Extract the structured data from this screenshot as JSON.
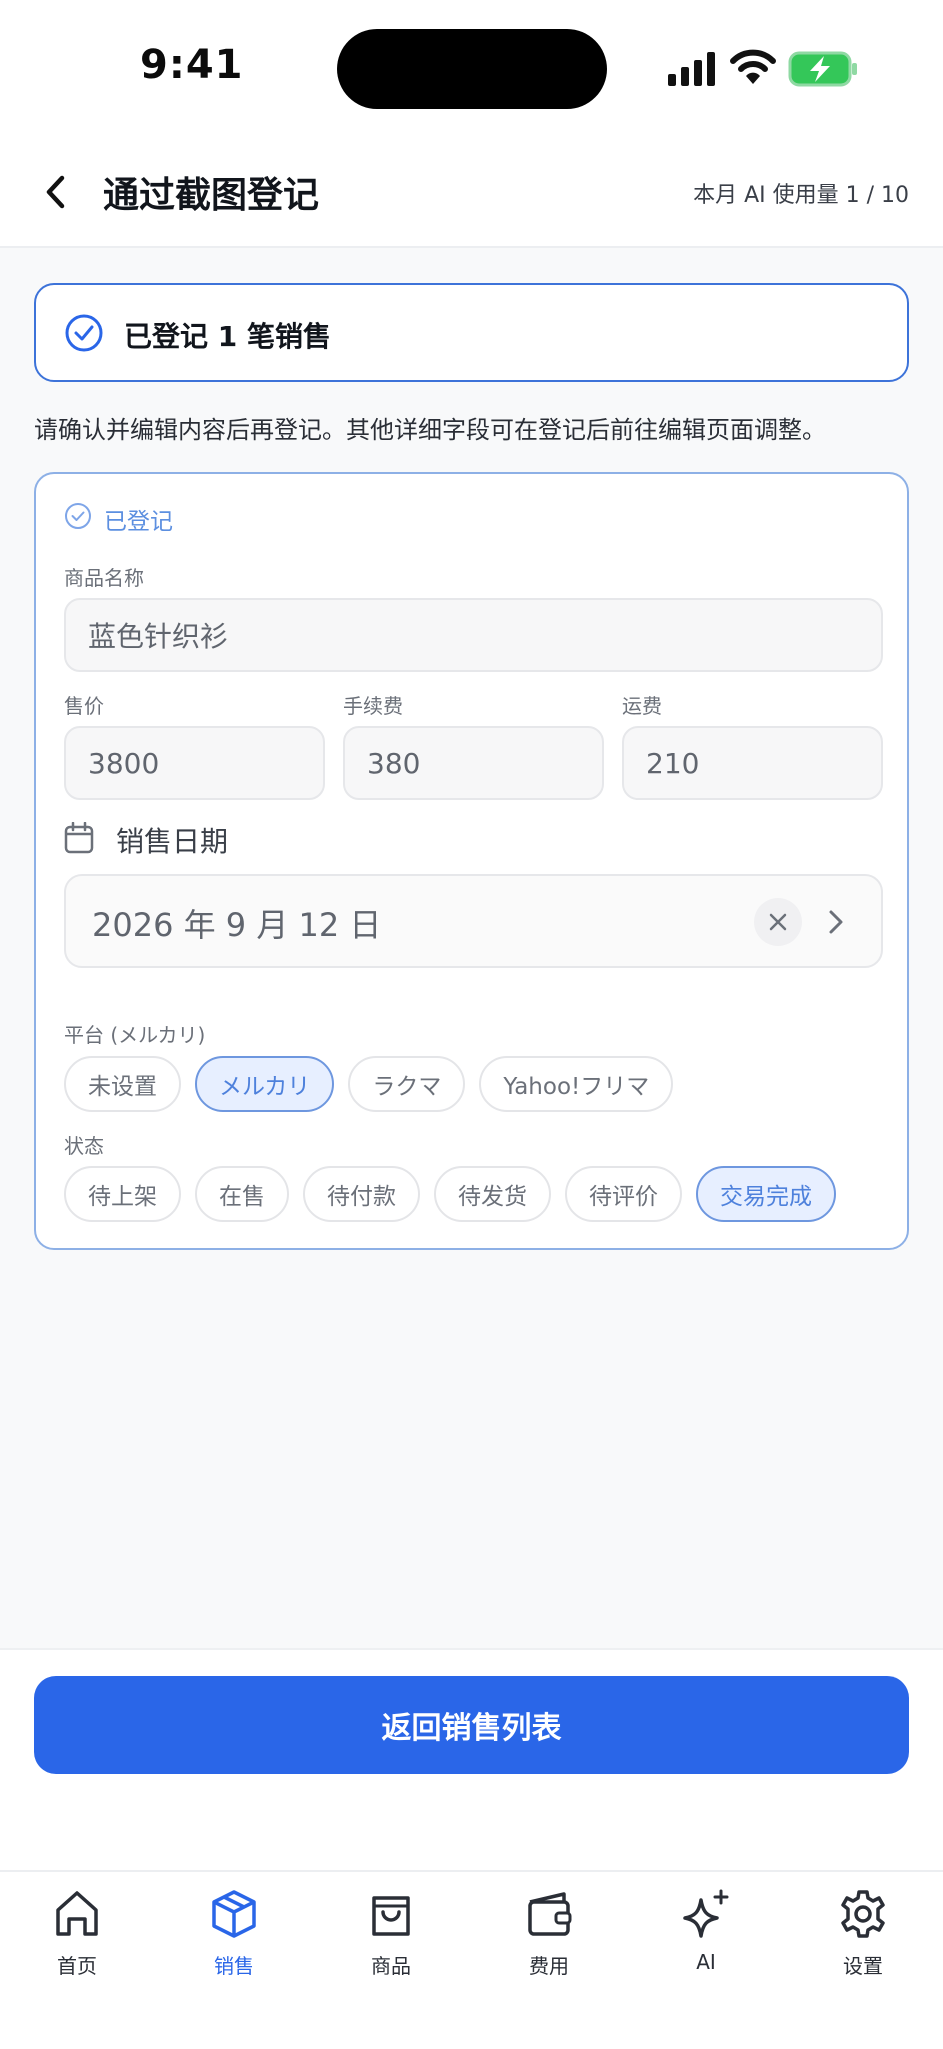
{
  "status_bar": {
    "time": "9:41"
  },
  "header": {
    "title": "通过截图登记",
    "usage": "本月 AI 使用量 1 / 10"
  },
  "banner": {
    "text": "已登记 1 笔销售"
  },
  "description": "请确认并编辑内容后再登记。其他详细字段可在登记后前往编辑页面调整。",
  "card": {
    "status": "已登记",
    "product_label": "商品名称",
    "product_value": "蓝色针织衫",
    "price_label": "售价",
    "price_value": "3800",
    "fee_label": "手续费",
    "fee_value": "380",
    "shipping_label": "运费",
    "shipping_value": "210",
    "date_label": "销售日期",
    "date_value": "2026 年 9 月 12 日",
    "platform_label": "平台 (メルカリ)",
    "platforms": [
      "未设置",
      "メルカリ",
      "ラクマ",
      "Yahoo!フリマ"
    ],
    "platform_selected": "メルカリ",
    "status_label": "状态",
    "statuses": [
      "待上架",
      "在售",
      "待付款",
      "待发货",
      "待评价",
      "交易完成"
    ],
    "status_selected": "交易完成"
  },
  "primary_button": "返回销售列表",
  "tabs": [
    {
      "label": "首页",
      "icon": "home-icon"
    },
    {
      "label": "销售",
      "icon": "box-icon",
      "active": true
    },
    {
      "label": "商品",
      "icon": "bag-icon"
    },
    {
      "label": "费用",
      "icon": "wallet-icon"
    },
    {
      "label": "AI",
      "icon": "sparkle-icon"
    },
    {
      "label": "设置",
      "icon": "gear-icon"
    }
  ],
  "colors": {
    "accent": "#2a66e8",
    "selected_chip_bg": "#e7efff",
    "battery": "#34c759"
  }
}
